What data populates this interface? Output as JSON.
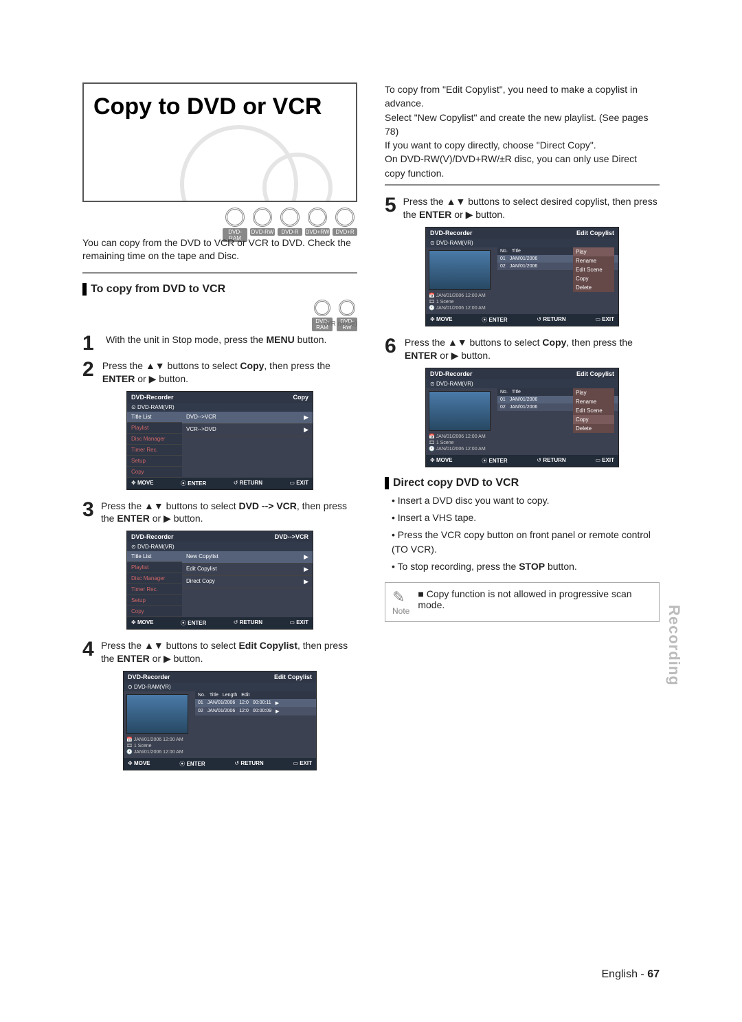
{
  "title": "Copy to DVD or VCR",
  "disc_badges": [
    "DVD-RAM",
    "DVD-RW",
    "DVD-R",
    "DVD+RW",
    "DVD+R"
  ],
  "intro": "You can copy from the DVD to VCR or VCR to DVD. Check the remaining time on the tape and Disc.",
  "section1_heading": "To copy from DVD to VCR",
  "mini_badges": [
    "DVD-RAM",
    "DVD-RW"
  ],
  "vr_mode_label": "(VR mode)",
  "steps_left": [
    {
      "n": "1",
      "html": "With the unit in Stop mode, press the <b>MENU</b> button."
    },
    {
      "n": "2",
      "html": "Press the ▲▼ buttons to select <b>Copy</b>, then press the <b>ENTER</b> or ▶ button."
    },
    {
      "n": "3",
      "html": "Press the ▲▼ buttons to select <b>DVD --> VCR</b>, then press the <b>ENTER</b> or ▶ button."
    },
    {
      "n": "4",
      "html": "Press the ▲▼ buttons to select <b>Edit Copylist</b>, then press the <b>ENTER</b> or ▶ button."
    }
  ],
  "right_intro": [
    "To copy from \"Edit Copylist\", you need to make a copylist in advance.",
    "Select \"New Copylist\" and create the new playlist. (See pages 78)",
    "If you want to copy directly, choose \"Direct Copy\".",
    "On DVD-RW(V)/DVD+RW/±R disc, you can only use Direct copy function."
  ],
  "steps_right": [
    {
      "n": "5",
      "html": "Press the ▲▼ buttons to select desired copylist, then press the <b>ENTER</b> or ▶ button."
    },
    {
      "n": "6",
      "html": "Press the ▲▼ buttons to select <b>Copy</b>, then press the <b>ENTER</b> or ▶ button."
    }
  ],
  "section2_heading": "Direct copy DVD to VCR",
  "section2_bullets": [
    "Insert a DVD disc you want to copy.",
    "Insert a VHS tape.",
    "Press the VCR copy button on front panel or remote control (TO VCR).",
    "To stop recording, press the STOP button."
  ],
  "note_label": "Note",
  "note_text": "Copy function is not allowed in progressive scan mode.",
  "side_tab": "Recording",
  "footer_lang": "English",
  "footer_page": "67",
  "scr_common": {
    "hdr_left": "DVD-Recorder",
    "sub": "DVD-RAM(VR)",
    "foot": [
      "MOVE",
      "ENTER",
      "RETURN",
      "EXIT"
    ]
  },
  "scrA": {
    "hdr_right": "Copy",
    "side": [
      "Title List",
      "Playlist",
      "Disc Manager",
      "Timer Rec.",
      "Setup",
      "Copy"
    ],
    "rows": [
      [
        "DVD-->VCR",
        "▶"
      ],
      [
        "VCR-->DVD",
        "▶"
      ]
    ]
  },
  "scrB": {
    "hdr_right": "DVD-->VCR",
    "side": [
      "Title List",
      "Playlist",
      "Disc Manager",
      "Timer Rec.",
      "Setup",
      "Copy"
    ],
    "rows": [
      [
        "New Copylist",
        "▶"
      ],
      [
        "Edit Copylist",
        "▶"
      ],
      [
        "Direct Copy",
        "▶"
      ]
    ]
  },
  "scrC": {
    "hdr_right": "Edit Copylist",
    "meta": [
      "JAN/01/2006 12:00 AM",
      "1 Scene",
      "JAN/01/2006 12:00 AM"
    ],
    "cols": [
      "No.",
      "Title",
      "Length",
      "Edit"
    ],
    "rows": [
      [
        "01",
        "JAN/01/2006",
        "12:0",
        "00:00:11",
        "▶"
      ],
      [
        "02",
        "JAN/01/2006",
        "12:0",
        "00:00:09",
        "▶"
      ]
    ]
  },
  "scrD": {
    "hdr_right": "Edit Copylist",
    "meta": [
      "JAN/01/2006 12:00 AM",
      "1 Scene",
      "JAN/01/2006 12:00 AM"
    ],
    "cols": [
      "No.",
      "Title"
    ],
    "rows": [
      [
        "01",
        "JAN/01/2006"
      ],
      [
        "02",
        "JAN/01/2006"
      ]
    ],
    "popup": [
      "Play",
      "Rename",
      "Edit Scene",
      "Copy",
      "Delete"
    ],
    "popup_sel": 0
  },
  "scrE": {
    "hdr_right": "Edit Copylist",
    "meta": [
      "JAN/01/2006 12:00 AM",
      "1 Scene",
      "JAN/01/2006 12:00 AM"
    ],
    "cols": [
      "No.",
      "Title"
    ],
    "rows": [
      [
        "01",
        "JAN/01/2006"
      ],
      [
        "02",
        "JAN/01/2006"
      ]
    ],
    "popup": [
      "Play",
      "Rename",
      "Edit Scene",
      "Copy",
      "Delete"
    ],
    "popup_sel": 3
  }
}
